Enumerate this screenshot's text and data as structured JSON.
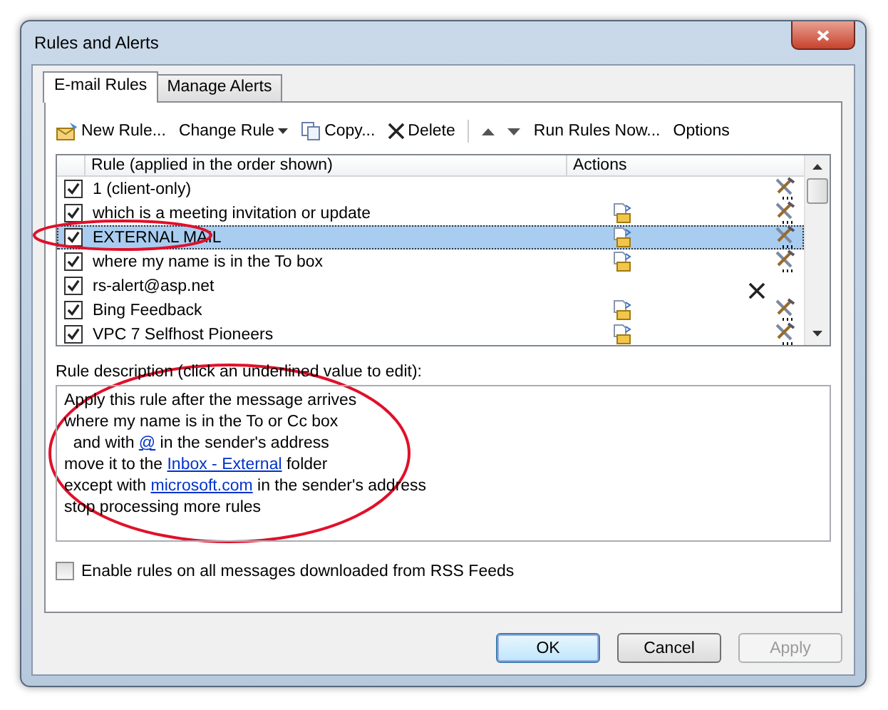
{
  "window": {
    "title": "Rules and Alerts"
  },
  "tabs": [
    {
      "label": "E-mail Rules",
      "selected": true
    },
    {
      "label": "Manage Alerts",
      "selected": false
    }
  ],
  "toolbar": [
    {
      "kind": "new",
      "label": "New Rule..."
    },
    {
      "kind": "dropdown",
      "label": "Change Rule"
    },
    {
      "kind": "copy",
      "label": "Copy..."
    },
    {
      "kind": "delete",
      "label": "Delete"
    },
    {
      "kind": "up"
    },
    {
      "kind": "down"
    },
    {
      "kind": "text",
      "label": "Run Rules Now..."
    },
    {
      "kind": "text",
      "label": "Options"
    }
  ],
  "table": {
    "columns": [
      "Rule (applied in the order shown)",
      "Actions"
    ],
    "rows": [
      {
        "name": "1  (client-only)",
        "checked": true,
        "selected": false,
        "actions": [
          {
            "kind": "tools"
          }
        ]
      },
      {
        "name": "which is a meeting invitation or update",
        "checked": true,
        "selected": false,
        "actions": [
          {
            "kind": "move"
          },
          {
            "kind": "tools"
          }
        ]
      },
      {
        "name": "EXTERNAL MAIL",
        "checked": true,
        "selected": true,
        "actions": [
          {
            "kind": "move"
          },
          {
            "kind": "tools"
          }
        ]
      },
      {
        "name": "where my name is in the To box",
        "checked": true,
        "selected": false,
        "actions": [
          {
            "kind": "move"
          },
          {
            "kind": "tools"
          }
        ]
      },
      {
        "name": "rs-alert@asp.net",
        "checked": true,
        "selected": false,
        "actions": [
          {
            "kind": "delete"
          }
        ]
      },
      {
        "name": "Bing Feedback",
        "checked": true,
        "selected": false,
        "actions": [
          {
            "kind": "move"
          },
          {
            "kind": "tools"
          }
        ]
      },
      {
        "name": "VPC 7 Selfhost Pioneers",
        "checked": true,
        "selected": false,
        "actions": [
          {
            "kind": "move"
          },
          {
            "kind": "tools"
          }
        ]
      }
    ]
  },
  "description": {
    "label": "Rule description (click an underlined value to edit):",
    "lines": [
      [
        {
          "kind": "text",
          "text": "Apply this rule after the message arrives"
        }
      ],
      [
        {
          "kind": "text",
          "text": "where my name is in the To or Cc box"
        }
      ],
      [
        {
          "kind": "text",
          "text": "  and with "
        },
        {
          "kind": "link",
          "text": "@"
        },
        {
          "kind": "text",
          "text": " in the sender's address"
        }
      ],
      [
        {
          "kind": "text",
          "text": "move it to the "
        },
        {
          "kind": "link",
          "text": "Inbox - External"
        },
        {
          "kind": "text",
          "text": " folder"
        }
      ],
      [
        {
          "kind": "text",
          "text": "except with "
        },
        {
          "kind": "link",
          "text": "microsoft.com"
        },
        {
          "kind": "text",
          "text": " in the sender's address"
        }
      ],
      [
        {
          "kind": "text",
          "text": "stop processing more rules"
        }
      ]
    ]
  },
  "rss_option": {
    "label": "Enable rules on all messages downloaded from RSS Feeds",
    "checked": false
  },
  "buttons": [
    {
      "label": "OK",
      "default": true,
      "disabled": false
    },
    {
      "label": "Cancel",
      "default": false,
      "disabled": false
    },
    {
      "label": "Apply",
      "default": false,
      "disabled": true
    }
  ]
}
